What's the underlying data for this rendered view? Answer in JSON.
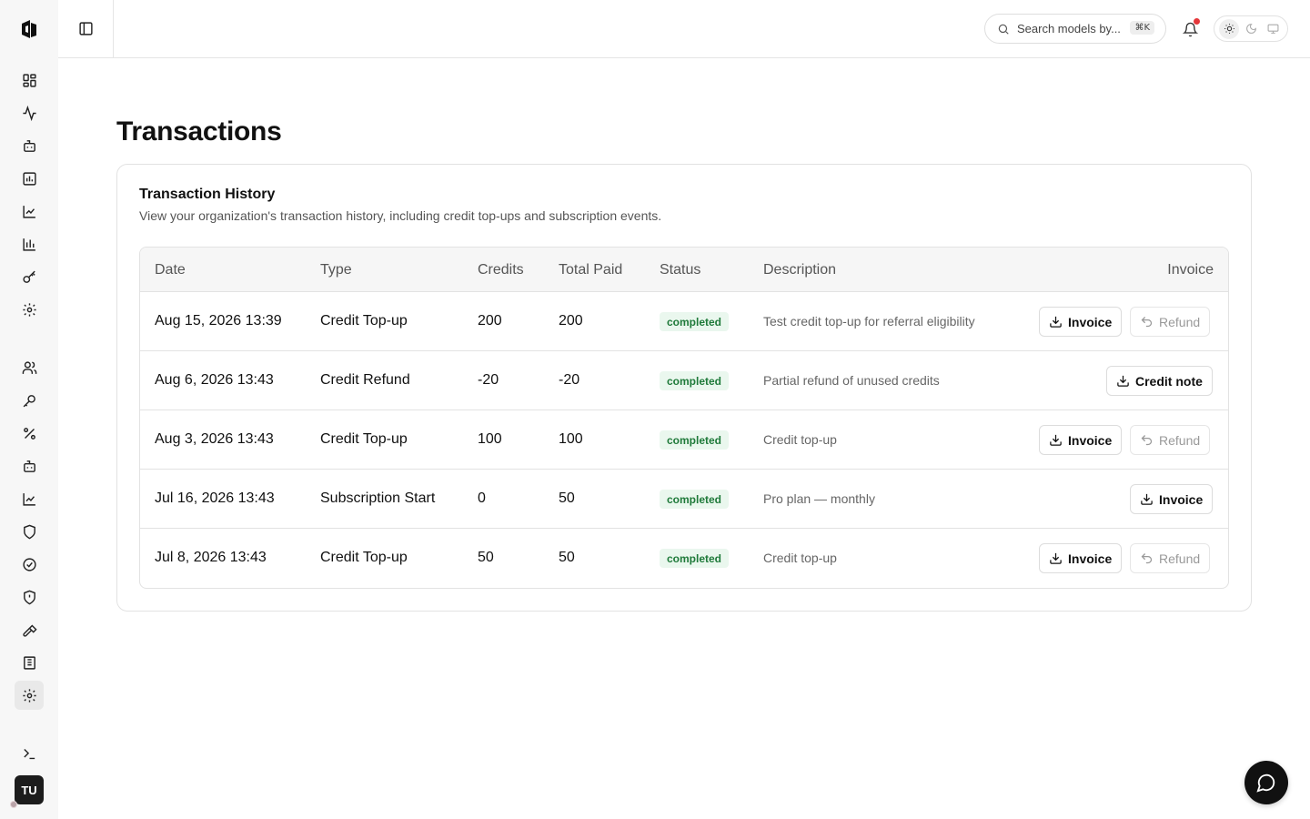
{
  "header": {
    "search_placeholder": "Search models by...",
    "search_shortcut": "⌘K"
  },
  "sidebar": {
    "avatar_initials": "TU",
    "icons": [
      "dashboard-icon",
      "activity-icon",
      "bot-icon",
      "bar-chart-icon",
      "line-chart-icon",
      "bar-chart-alt-icon",
      "key-icon",
      "settings-icon",
      "users-icon",
      "key-round-icon",
      "percent-icon",
      "bot-alt-icon",
      "trend-icon",
      "shield-icon",
      "badge-check-icon",
      "shield-alert-icon",
      "hammer-icon",
      "building-icon",
      "settings-active-icon",
      "terminal-icon"
    ]
  },
  "page": {
    "title": "Transactions",
    "card_title": "Transaction History",
    "card_description": "View your organization's transaction history, including credit top-ups and subscription events."
  },
  "table": {
    "columns": [
      "Date",
      "Type",
      "Credits",
      "Total Paid",
      "Status",
      "Description",
      "Invoice"
    ],
    "rows": [
      {
        "date": "Aug 15, 2026 13:39",
        "type": "Credit Top-up",
        "credits": "200",
        "total_paid": "200",
        "status": "completed",
        "description": "Test credit top-up for referral eligibility",
        "actions": [
          {
            "label": "Invoice",
            "kind": "download"
          },
          {
            "label": "Refund",
            "kind": "refund"
          }
        ]
      },
      {
        "date": "Aug 6, 2026 13:43",
        "type": "Credit Refund",
        "credits": "-20",
        "total_paid": "-20",
        "status": "completed",
        "description": "Partial refund of unused credits",
        "actions": [
          {
            "label": "Credit note",
            "kind": "download"
          }
        ]
      },
      {
        "date": "Aug 3, 2026 13:43",
        "type": "Credit Top-up",
        "credits": "100",
        "total_paid": "100",
        "status": "completed",
        "description": "Credit top-up",
        "actions": [
          {
            "label": "Invoice",
            "kind": "download"
          },
          {
            "label": "Refund",
            "kind": "refund"
          }
        ]
      },
      {
        "date": "Jul 16, 2026 13:43",
        "type": "Subscription Start",
        "credits": "0",
        "total_paid": "50",
        "status": "completed",
        "description": "Pro plan — monthly",
        "actions": [
          {
            "label": "Invoice",
            "kind": "download"
          }
        ]
      },
      {
        "date": "Jul 8, 2026 13:43",
        "type": "Credit Top-up",
        "credits": "50",
        "total_paid": "50",
        "status": "completed",
        "description": "Credit top-up",
        "actions": [
          {
            "label": "Invoice",
            "kind": "download"
          },
          {
            "label": "Refund",
            "kind": "refund"
          }
        ]
      }
    ]
  },
  "colors": {
    "status_completed_bg": "#eaf7ee",
    "status_completed_text": "#1f7a3a",
    "notification_dot": "#e5383b",
    "accent_dark": "#111111"
  }
}
